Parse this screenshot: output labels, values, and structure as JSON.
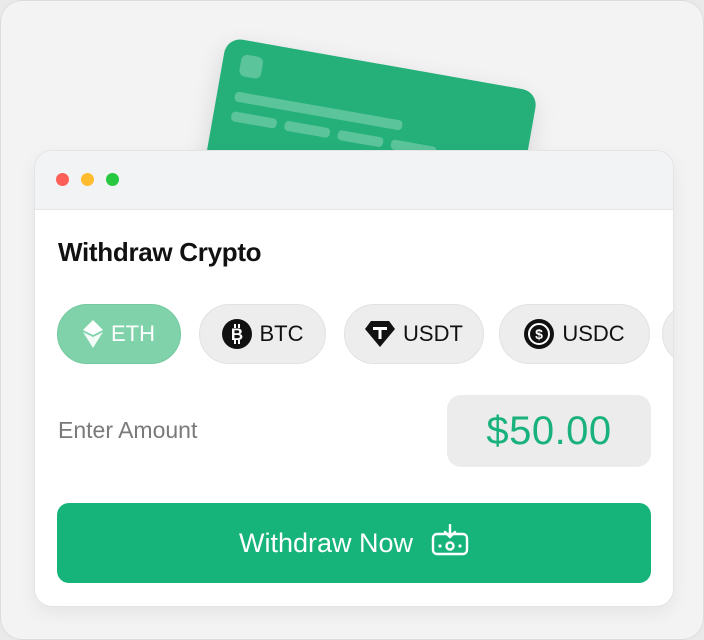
{
  "window": {
    "title": "Withdraw Crypto",
    "controls": [
      "close",
      "minimize",
      "maximize"
    ],
    "control_colors": {
      "close": "#ff5f57",
      "minimize": "#febc2e",
      "maximize": "#28c840"
    }
  },
  "currencies": [
    {
      "label": "ETH",
      "icon": "eth-icon",
      "selected": true
    },
    {
      "label": "BTC",
      "icon": "btc-icon",
      "selected": false
    },
    {
      "label": "USDT",
      "icon": "usdt-icon",
      "selected": false
    },
    {
      "label": "USDC",
      "icon": "usdc-icon",
      "selected": false
    }
  ],
  "amount": {
    "label": "Enter Amount",
    "value": "$50.00"
  },
  "action": {
    "label": "Withdraw Now",
    "icon": "withdraw-icon"
  },
  "colors": {
    "accent": "#16b47b",
    "selected_chip": "#7fd2a9",
    "amount_text": "#19b27c"
  }
}
